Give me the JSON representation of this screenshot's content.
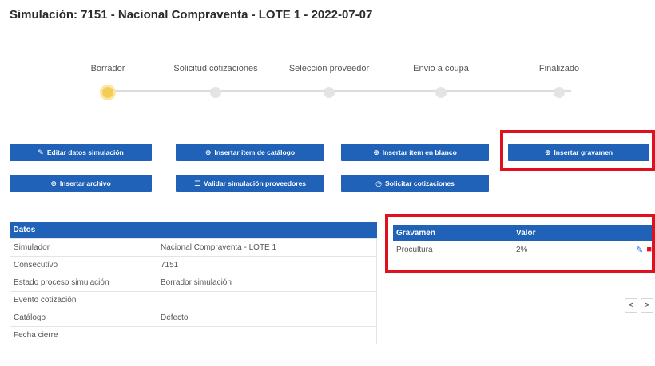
{
  "page": {
    "title": "Simulación: 7151 - Nacional Compraventa - LOTE 1 - 2022-07-07"
  },
  "stepper": {
    "steps": [
      {
        "label": "Borrador",
        "active": true
      },
      {
        "label": "Solicitud cotizaciones",
        "active": false
      },
      {
        "label": "Selección proveedor",
        "active": false
      },
      {
        "label": "Envio a coupa",
        "active": false
      },
      {
        "label": "Finalizado",
        "active": false
      }
    ]
  },
  "actions": {
    "edit_simulation": "Editar datos simulación",
    "insert_catalog_item": "Insertar ítem de catálogo",
    "insert_blank_item": "Insertar ítem en blanco",
    "insert_gravamen": "Insertar gravamen",
    "insert_file": "Insertar archivo",
    "validate_providers": "Validar simulación proveedores",
    "request_quotes": "Solicitar cotizaciones"
  },
  "icons": {
    "edit": "edit-icon",
    "plus_circle": "plus-circle-icon",
    "list": "list-icon",
    "clock": "clock-icon",
    "trash": "trash-icon"
  },
  "datos": {
    "header": "Datos",
    "rows": [
      {
        "label": "Simulador",
        "value": "Nacional Compraventa - LOTE 1"
      },
      {
        "label": "Consecutivo",
        "value": "7151"
      },
      {
        "label": "Estado proceso simulación",
        "value": "Borrador simulación"
      },
      {
        "label": "Evento cotización",
        "value": ""
      },
      {
        "label": "Catálogo",
        "value": "Defecto"
      },
      {
        "label": "Fecha cierre",
        "value": ""
      }
    ]
  },
  "gravamen": {
    "headers": {
      "name": "Gravamen",
      "value": "Valor"
    },
    "rows": [
      {
        "name": "Procultura",
        "value": "2%"
      }
    ]
  },
  "pager": {
    "prev": "<",
    "next": ">"
  },
  "colors": {
    "primary": "#1f62b8",
    "highlight": "#e0101d",
    "active_step": "#f4cd55"
  }
}
